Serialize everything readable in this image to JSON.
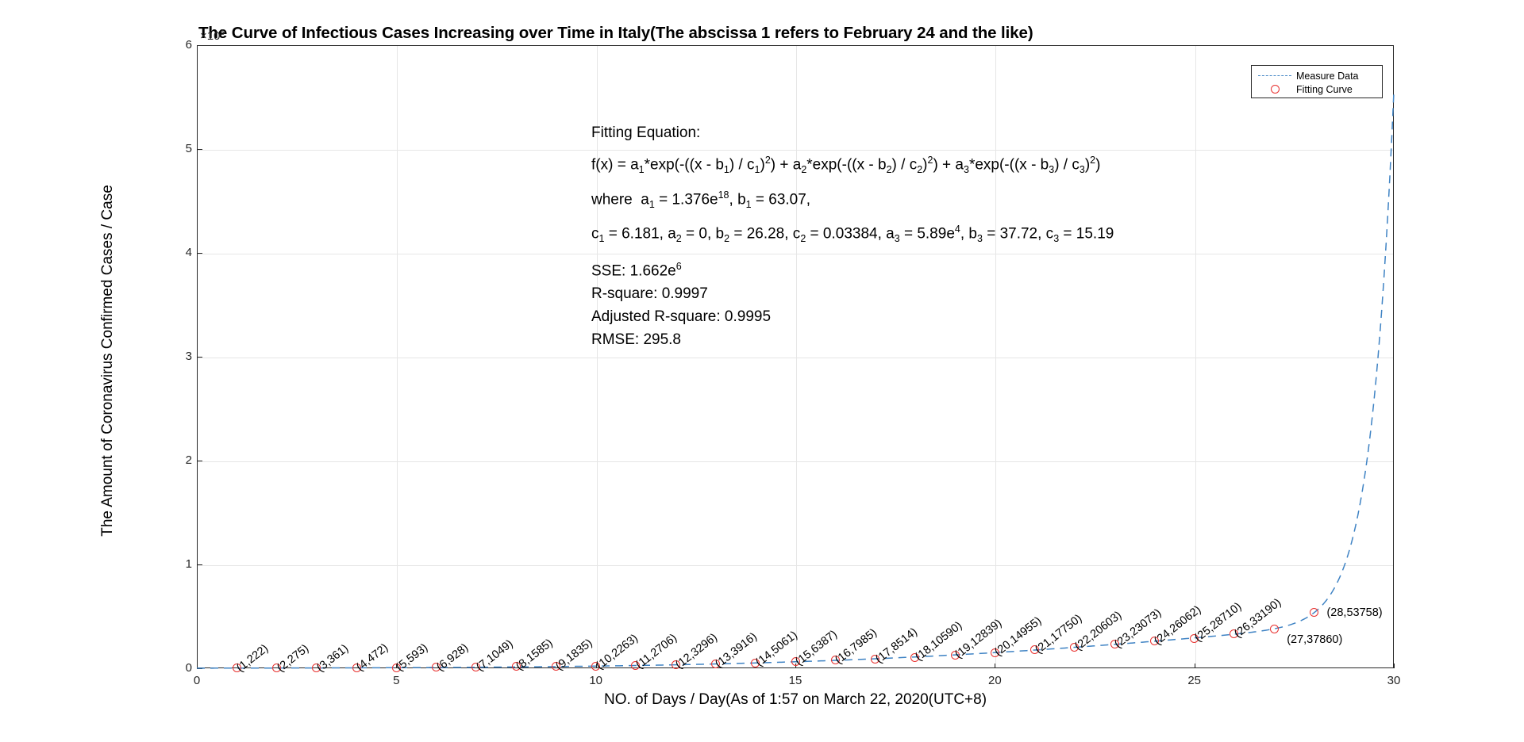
{
  "title": "The Curve of Infectious Cases Increasing over Time in Italy(The abscissa 1 refers to February 24 and the like)",
  "axes": {
    "y_exponent_prefix": "×10",
    "y_exponent_power": "5",
    "ylabel": "The Amount of Coronavirus Confirmed Cases / Case",
    "xlabel": "NO. of Days / Day(As of 1:57 on March 22, 2020(UTC+8)",
    "xticks": [
      "0",
      "5",
      "10",
      "15",
      "20",
      "25",
      "30"
    ],
    "yticks": [
      "0",
      "1",
      "2",
      "3",
      "4",
      "5",
      "6"
    ]
  },
  "legend": {
    "items": [
      {
        "label": "Measure Data",
        "style": "dashed-line",
        "color": "#3f83c4"
      },
      {
        "label": "Fitting Curve",
        "style": "circle-marker",
        "color": "#e8312f"
      }
    ]
  },
  "equation": {
    "heading": "Fitting Equation:",
    "formula_plain": "f(x) = a1*exp(-((x - b1) / c1)^2) + a2*exp(-((x - b2) / c2)^2) + a3*exp(-((x - b3) / c3)^2)",
    "where_line_plain": "where  a1 = 1.376e18, b1 = 63.07,",
    "params_line_plain": "c1 = 6.181, a2 = 0, b2 = 26.28, c2 = 0.03384, a3 = 5.89e4, b3 = 37.72, c3 = 15.19",
    "params": {
      "a1": "1.376e18",
      "b1": "63.07",
      "c1": "6.181",
      "a2": "0",
      "b2": "26.28",
      "c2": "0.03384",
      "a3": "5.89e4",
      "b3": "37.72",
      "c3": "15.19"
    },
    "stats": {
      "sse_label": "SSE:",
      "sse_value": "1.662e",
      "sse_exp": "6",
      "rsquare": "R-square: 0.9997",
      "adj_rsquare": "Adjusted R-square: 0.9995",
      "rmse": "RMSE: 295.8"
    }
  },
  "chart_data": {
    "type": "scatter",
    "title": "The Curve of Infectious Cases Increasing over Time in Italy(The abscissa 1 refers to February 24 and the like)",
    "xlabel": "NO. of Days / Day(As of 1:57 on March 22, 2020(UTC+8)",
    "ylabel": "The Amount of Coronavirus Confirmed Cases / Case",
    "xlim": [
      0,
      30
    ],
    "ylim": [
      0,
      600000
    ],
    "y_scale_factor": 100000,
    "grid": true,
    "legend_position": "top-right",
    "series": [
      {
        "name": "Fitting Curve",
        "style": "circle-marker",
        "color": "#e8312f",
        "x": [
          1,
          2,
          3,
          4,
          5,
          6,
          7,
          8,
          9,
          10,
          11,
          12,
          13,
          14,
          15,
          16,
          17,
          18,
          19,
          20,
          21,
          22,
          23,
          24,
          25,
          26,
          27,
          28
        ],
        "values": [
          222,
          275,
          361,
          472,
          593,
          928,
          1049,
          1585,
          1835,
          2263,
          2706,
          3296,
          3916,
          5061,
          6387,
          7985,
          8514,
          10590,
          12839,
          14955,
          17750,
          20603,
          23073,
          26062,
          28710,
          33190,
          37860,
          53758
        ],
        "point_labels": [
          "(1,222)",
          "(2,275)",
          "(3,361)",
          "(4,472)",
          "(5,593)",
          "(6,928)",
          "(7,1049)",
          "(8,1585)",
          "(9,1835)",
          "(10,2263)",
          "(11,2706)",
          "(12,3296)",
          "(13,3916)",
          "(14,5061)",
          "(15,6387)",
          "(16,7985)",
          "(17,8514)",
          "(18,10590)",
          "(19,12839)",
          "(20,14955)",
          "(21,17750)",
          "(22,20603)",
          "(23,23073)",
          "(24,26062)",
          "(25,28710)",
          "(26,33190)",
          "(27,37860)",
          "(28,53758)"
        ]
      },
      {
        "name": "Measure Data",
        "style": "dashed-line",
        "color": "#3f83c4",
        "note": "Gaussian fit curve rising steeply past x=28 toward ~5.5e5 at x=30"
      }
    ]
  }
}
